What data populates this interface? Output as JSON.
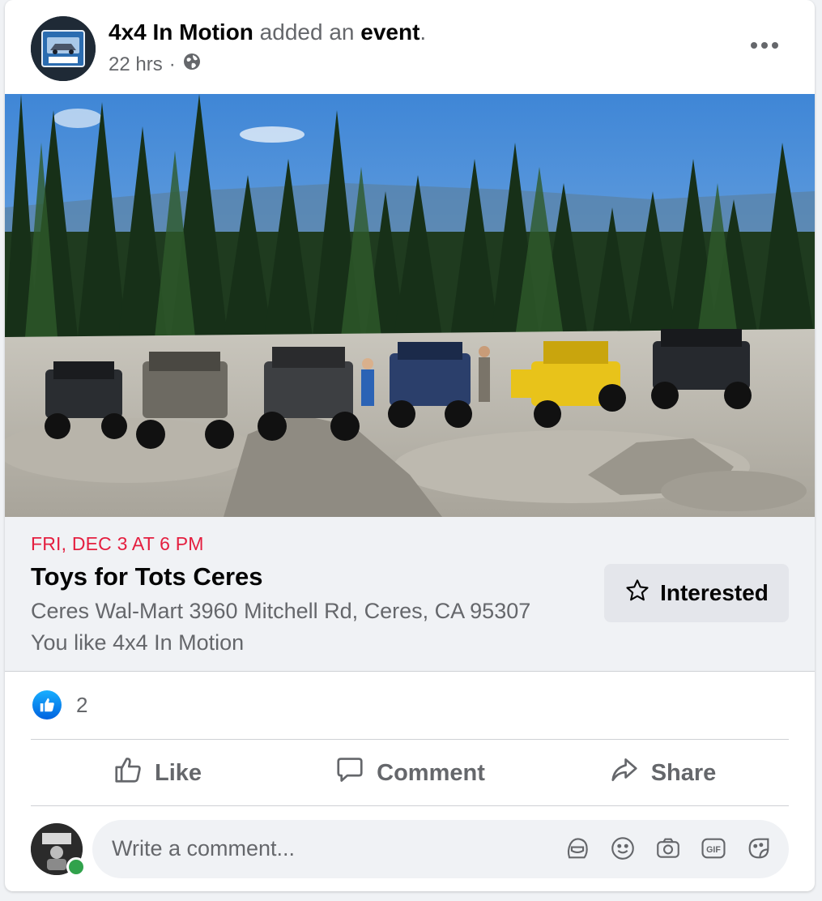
{
  "post": {
    "page_name": "4x4 In Motion",
    "verb": " added an ",
    "object": "event",
    "period": ".",
    "time": "22 hrs",
    "separator": "·",
    "privacy_icon": "globe-icon"
  },
  "event": {
    "date": "FRI, DEC 3 AT 6 PM",
    "title": "Toys for Tots Ceres",
    "location": "Ceres Wal-Mart 3960 Mitchell Rd, Ceres, CA 95307",
    "social": "You like 4x4 In Motion",
    "interested_label": "Interested",
    "interested_icon": "star-icon"
  },
  "reactions": {
    "icon": "like-icon",
    "count": "2"
  },
  "actions": {
    "like": "Like",
    "comment": "Comment",
    "share": "Share"
  },
  "composer": {
    "placeholder": "Write a comment...",
    "icons": [
      "avatar-sticker-icon",
      "emoji-icon",
      "camera-icon",
      "gif-icon",
      "sticker-icon"
    ]
  },
  "colors": {
    "accent_blue": "#1877f2",
    "date_red": "#e41e3f",
    "secondary_text": "#65676b",
    "online_green": "#31a24c"
  }
}
